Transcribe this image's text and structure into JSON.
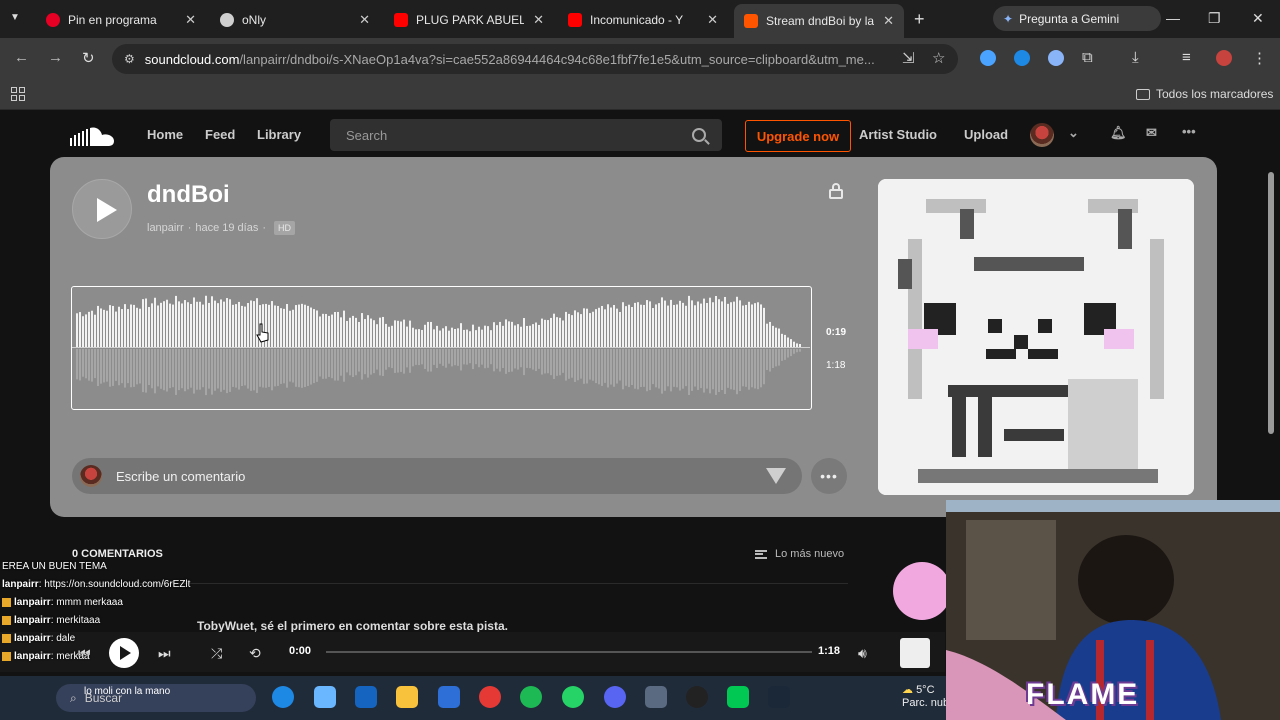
{
  "browser": {
    "tabs": [
      {
        "title": "Pin en programa",
        "color": "#e60023"
      },
      {
        "title": "oNly",
        "color": "#cfcfcf"
      },
      {
        "title": "PLUG PARK ABUELO -",
        "color": "#ff0000"
      },
      {
        "title": "Incomunicado - Y",
        "color": "#ff0000"
      },
      {
        "title": "Stream dndBoi by lan",
        "color": "#ff5500"
      }
    ],
    "gemini_label": "Pregunta a Gemini",
    "url_host": "soundcloud.com",
    "url_path": "/lanpairr/dndboi/s-XNaeOp1a4va?si=cae552a86944464c94c68e1fbf7fe1e5&utm_source=clipboard&utm_me...",
    "bookmarks_label": "Todos los marcadores"
  },
  "soundcloud": {
    "nav": {
      "home": "Home",
      "feed": "Feed",
      "library": "Library"
    },
    "search_placeholder": "Search",
    "upgrade_label": "Upgrade now",
    "artist_studio": "Artist Studio",
    "upload": "Upload",
    "accent": "#ff5500"
  },
  "track": {
    "title": "dndBoi",
    "artist": "lanpairr",
    "posted": "hace 19 días",
    "quality_badge": "HD",
    "current_time": "0:19",
    "duration": "1:18",
    "played_fraction": 0.0
  },
  "comments": {
    "input_placeholder": "Escribe un comentario",
    "count_label": "0 COMENTARIOS",
    "sort_label": "Lo más nuevo",
    "empty_text": "TobyWuet, sé el primero en comentar sobre esta pista."
  },
  "chat": {
    "lines": [
      {
        "user": "",
        "text": "EREA UN BUEN TEMA"
      },
      {
        "user": "lanpairr",
        "text": "https://on.soundcloud.com/6rEZlt"
      },
      {
        "user": "lanpairr",
        "text": "mmm merkaaa"
      },
      {
        "user": "lanpairr",
        "text": "merkitaaa"
      },
      {
        "user": "lanpairr",
        "text": "dale"
      },
      {
        "user": "lanpairr",
        "text": "merkaa"
      },
      {
        "user": "",
        "text": "lo moli con la mano"
      }
    ]
  },
  "player": {
    "current": "0:00",
    "duration": "1:18"
  },
  "taskbar": {
    "search_placeholder": "Buscar",
    "weather_temp": "5°C",
    "weather_text": "Parc. nub"
  },
  "overlay": {
    "brand": "FLAME"
  }
}
